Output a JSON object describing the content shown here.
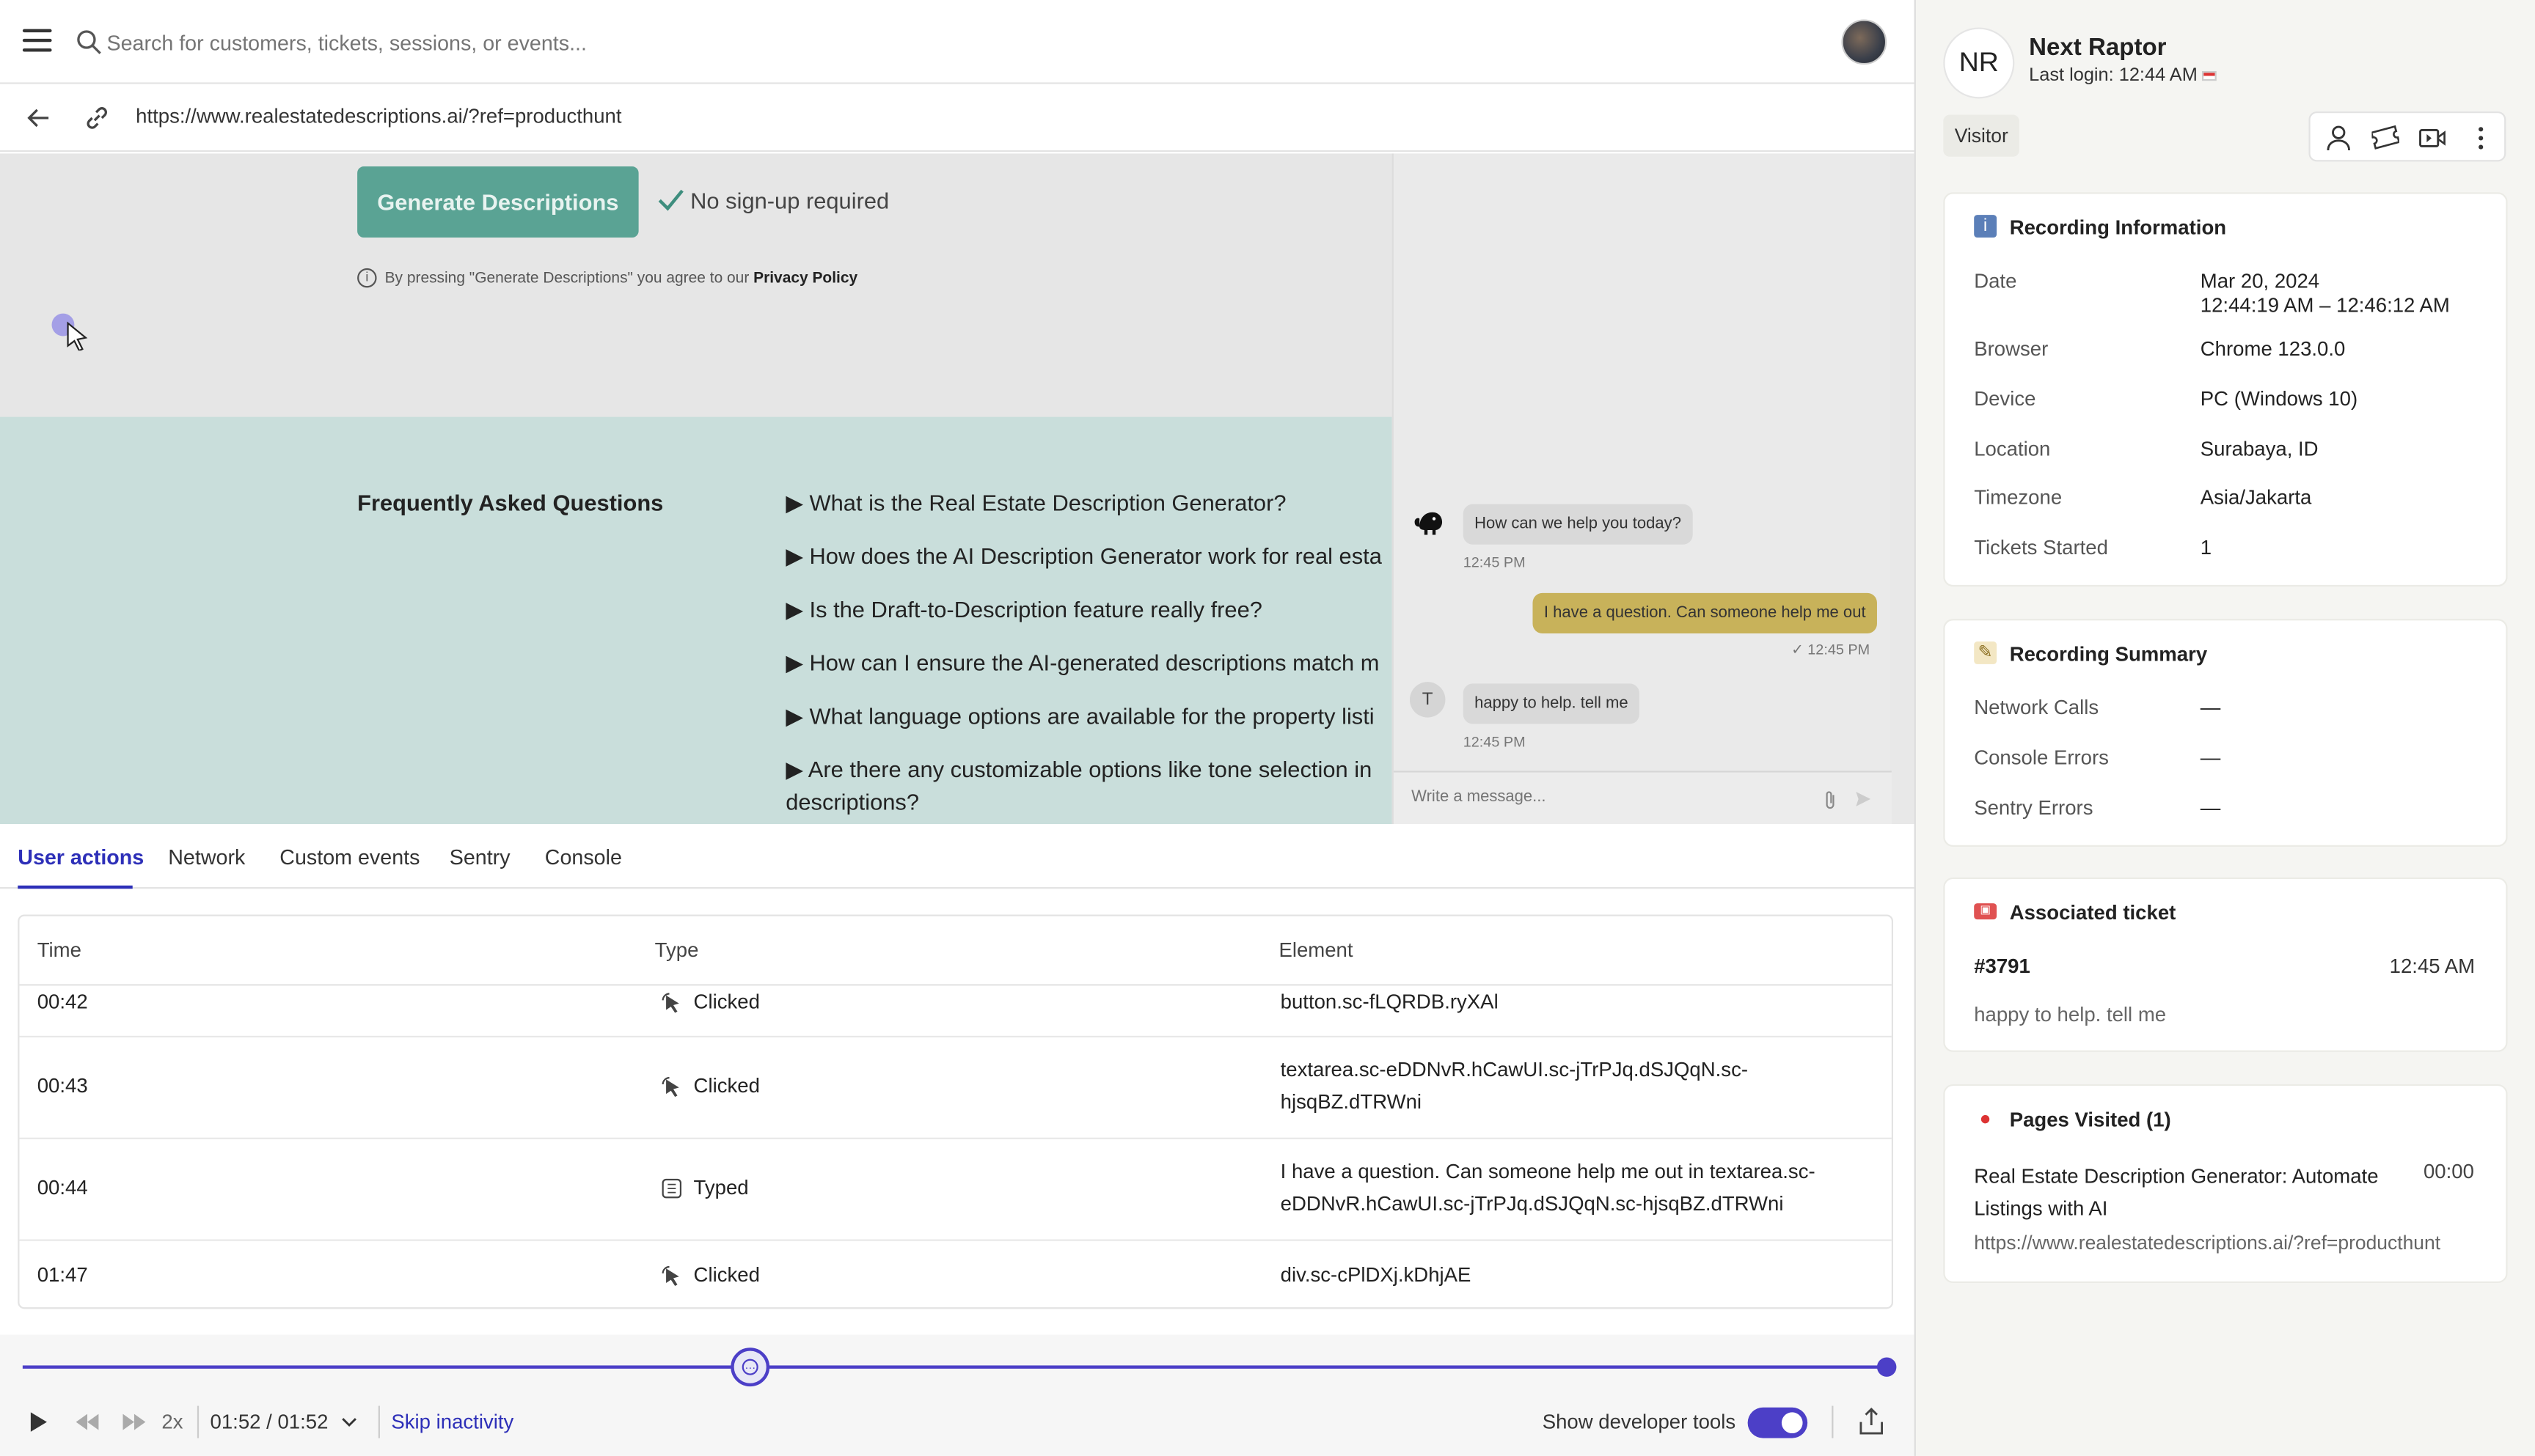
{
  "topbar": {
    "search_placeholder": "Search for customers, tickets, sessions, or events..."
  },
  "urlbar": {
    "url": "https://www.realestatedescriptions.ai/?ref=producthunt"
  },
  "replay": {
    "generate_button": "Generate Descriptions",
    "no_signup": "No sign-up required",
    "agree_prefix": "By pressing \"Generate Descriptions\" you agree to our ",
    "privacy_link": "Privacy Policy",
    "faq_title": "Frequently Asked Questions",
    "faq_items": [
      "▶ What is the Real Estate Description Generator?",
      "▶ How does the AI Description Generator work for real esta",
      "▶ Is the Draft-to-Description feature really free?",
      "▶ How can I ensure the AI-generated descriptions match m",
      "▶ What language options are available for the property listi",
      "▶ Are there any customizable options like tone selection in descriptions?"
    ],
    "chat": {
      "msg1": "How can we help you today?",
      "msg1_time": "12:45 PM",
      "msg2": "I have a question. Can someone help me out",
      "msg2_time": "✓ 12:45 PM",
      "agent_initial": "T",
      "msg3": "happy to help. tell me",
      "msg3_time": "12:45 PM",
      "input_placeholder": "Write a message..."
    }
  },
  "devtools": {
    "tabs": [
      "User actions",
      "Network",
      "Custom events",
      "Sentry",
      "Console"
    ],
    "columns": [
      "Time",
      "Type",
      "Element"
    ],
    "rows": [
      {
        "time": "00:42",
        "type": "Clicked",
        "element": "button.sc-fLQRDB.ryXAl"
      },
      {
        "time": "00:43",
        "type": "Clicked",
        "element": "textarea.sc-eDDNvR.hCawUI.sc-jTrPJq.dSJQqN.sc-hjsqBZ.dTRWni"
      },
      {
        "time": "00:44",
        "type": "Typed",
        "element": "I have a question. Can someone help me out in textarea.sc-eDDNvR.hCawUI.sc-jTrPJq.dSJQqN.sc-hjsqBZ.dTRWni"
      },
      {
        "time": "01:47",
        "type": "Clicked",
        "element": "div.sc-cPlDXj.kDhjAE"
      }
    ]
  },
  "player": {
    "progress": 0.39,
    "speed": "2x",
    "time": "01:52 / 01:52",
    "skip_label": "Skip inactivity",
    "devtools_label": "Show developer tools",
    "devtools_on": true,
    "accent": "#4c3fc7"
  },
  "panel": {
    "initials": "NR",
    "name": "Next Raptor",
    "last_login": "Last login: 12:44 AM",
    "role_badge": "Visitor",
    "recording_info": {
      "title": "Recording Information",
      "fields": [
        {
          "k": "Date",
          "v": "Mar 20, 2024",
          "v2": "12:44:19 AM – 12:46:12 AM"
        },
        {
          "k": "Browser",
          "v": "Chrome 123.0.0"
        },
        {
          "k": "Device",
          "v": "PC (Windows 10)"
        },
        {
          "k": "Location",
          "v": "Surabaya, ID"
        },
        {
          "k": "Timezone",
          "v": "Asia/Jakarta"
        },
        {
          "k": "Tickets Started",
          "v": "1"
        }
      ]
    },
    "recording_summary": {
      "title": "Recording Summary",
      "fields": [
        {
          "k": "Network Calls",
          "v": "—"
        },
        {
          "k": "Console Errors",
          "v": "—"
        },
        {
          "k": "Sentry Errors",
          "v": "—"
        }
      ]
    },
    "ticket": {
      "title": "Associated ticket",
      "id": "#3791",
      "time": "12:45 AM",
      "text": "happy to help. tell me"
    },
    "pages": {
      "title": "Pages Visited (1)",
      "page_title": "Real Estate Description Generator: Automate Listings with AI",
      "duration": "00:00",
      "url": "https://www.realestatedescriptions.ai/?ref=producthunt"
    }
  }
}
